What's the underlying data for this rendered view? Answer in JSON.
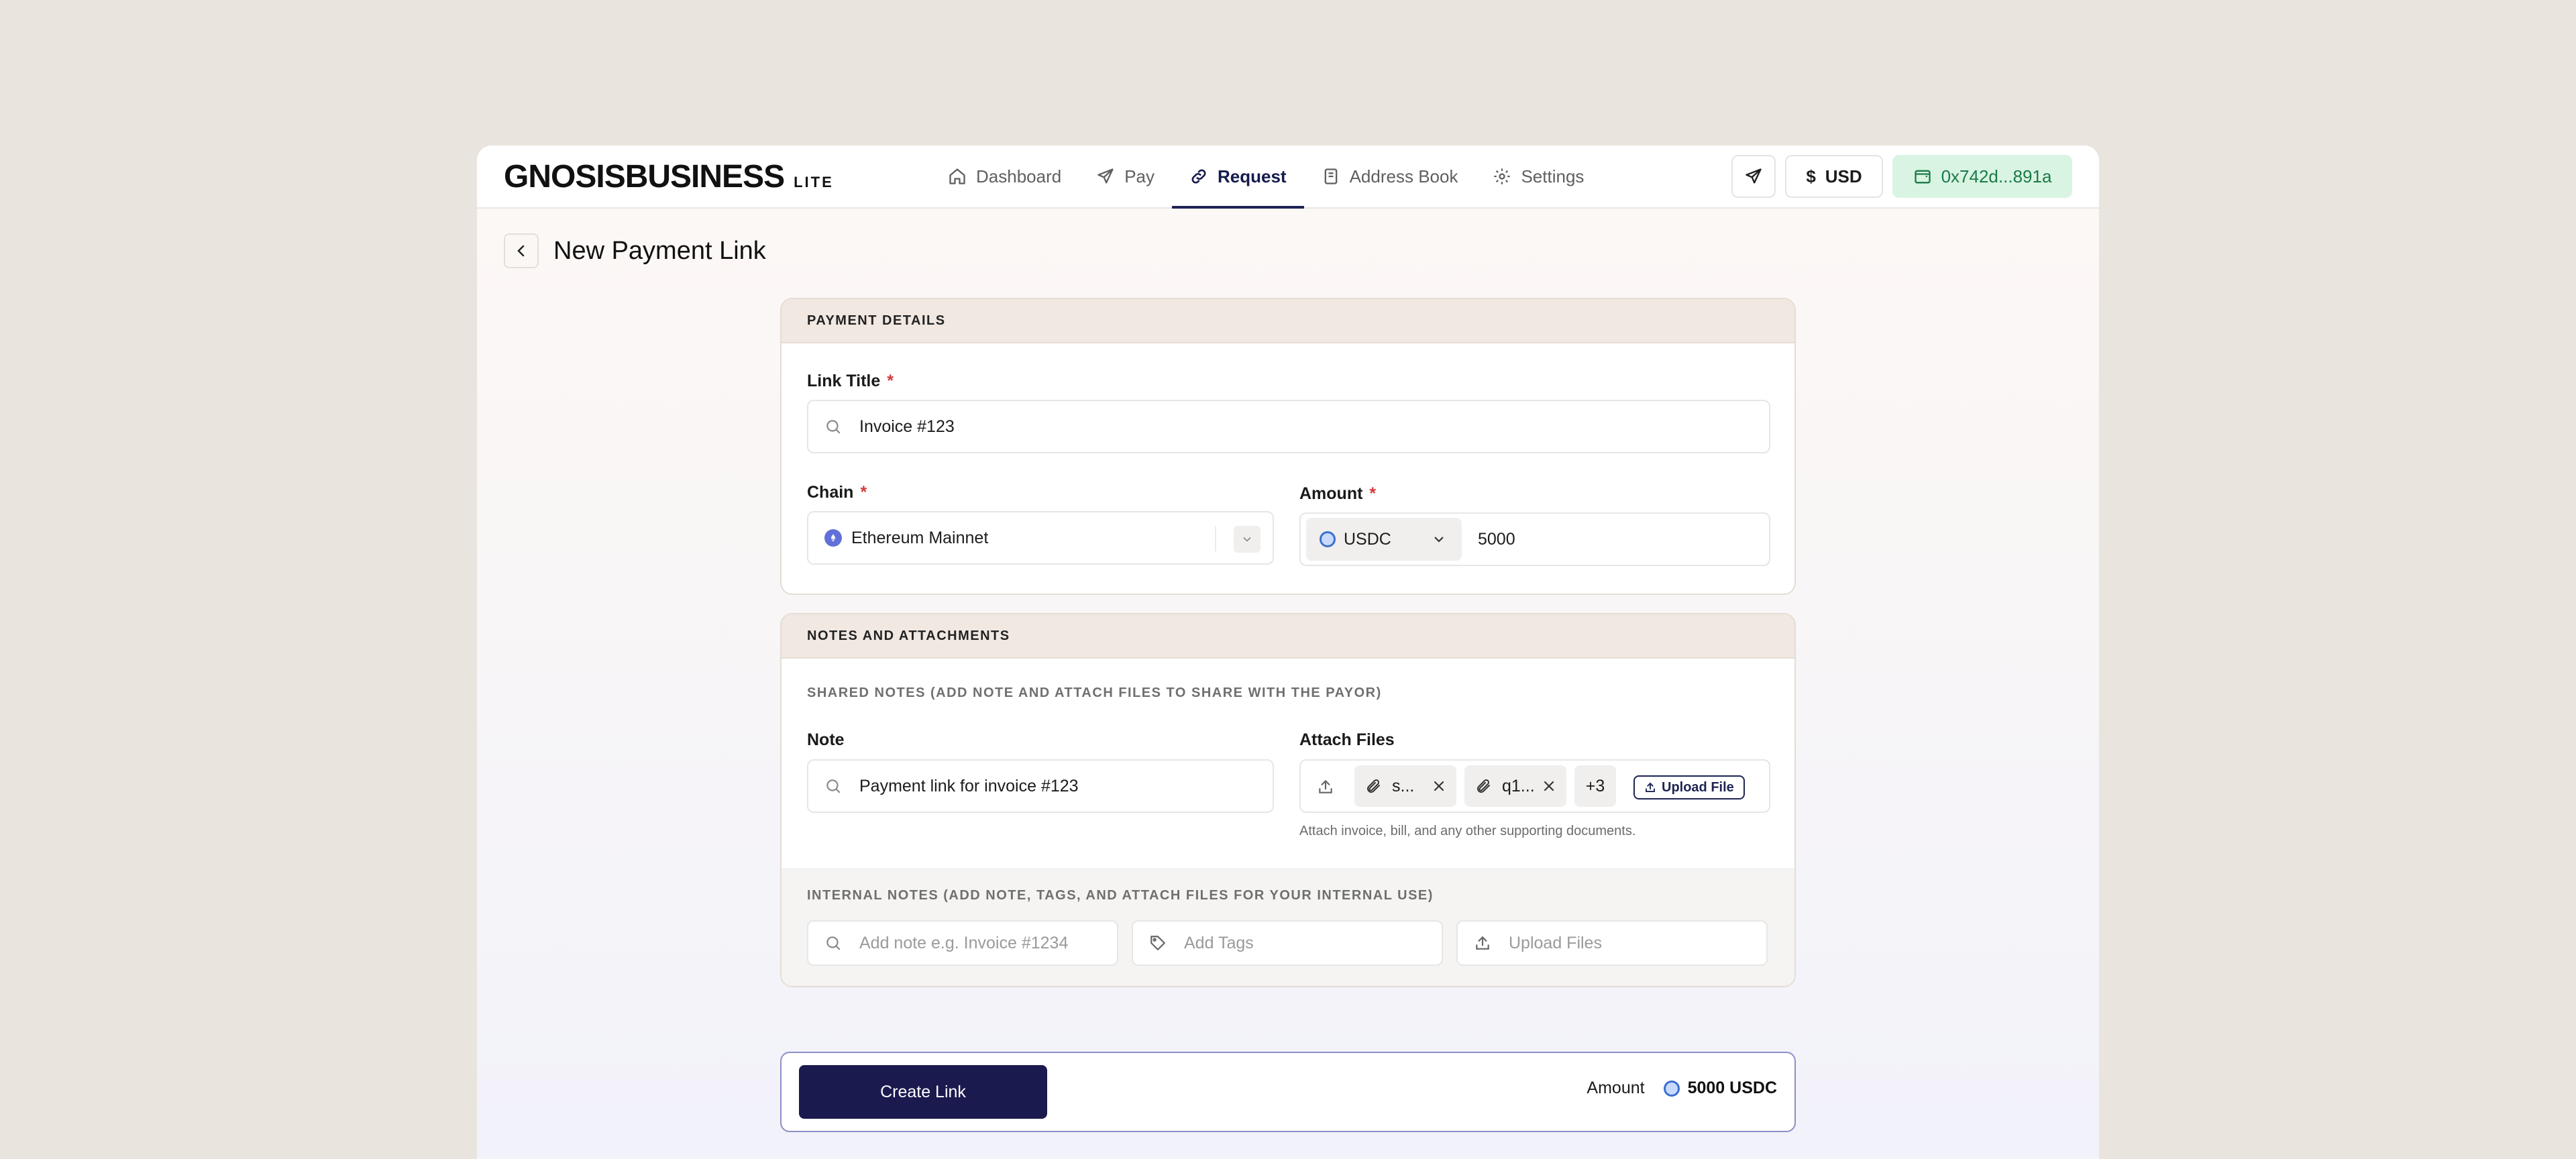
{
  "header": {
    "logo_main": "GNOSISBUSINESS",
    "logo_sub": "LITE",
    "nav": [
      {
        "label": "Dashboard",
        "icon": "home-icon",
        "active": false
      },
      {
        "label": "Pay",
        "icon": "send-icon",
        "active": false
      },
      {
        "label": "Request",
        "icon": "link-icon",
        "active": true
      },
      {
        "label": "Address Book",
        "icon": "book-icon",
        "active": false
      },
      {
        "label": "Settings",
        "icon": "gear-icon",
        "active": false
      }
    ],
    "currency_label": "USD",
    "wallet_address": "0x742d...891a"
  },
  "page": {
    "title": "New Payment Link"
  },
  "payment_details": {
    "section_title": "PAYMENT DETAILS",
    "link_title_label": "Link Title",
    "link_title_value": "Invoice #123",
    "chain_label": "Chain",
    "chain_value": "Ethereum Mainnet",
    "amount_label": "Amount",
    "token": "USDC",
    "amount_value": "5000",
    "required_mark": "*"
  },
  "notes": {
    "section_title": "NOTES AND ATTACHMENTS",
    "shared_heading": "SHARED NOTES (ADD NOTE AND ATTACH FILES TO SHARE WITH THE PAYOR)",
    "note_label": "Note",
    "note_value": "Payment link for invoice #123",
    "attach_label": "Attach Files",
    "files": [
      "s...",
      "q1..."
    ],
    "more_count": "+3",
    "upload_button": "Upload File",
    "attach_hint": "Attach invoice, bill, and any other supporting documents.",
    "internal_heading": "INTERNAL NOTES (ADD NOTE, TAGS, AND ATTACH FILES FOR YOUR INTERNAL USE)",
    "internal_note_placeholder": "Add note e.g. Invoice #1234",
    "tags_placeholder": "Add Tags",
    "upload_files_placeholder": "Upload Files"
  },
  "footer": {
    "create_button": "Create Link",
    "amount_label": "Amount",
    "amount_value": "5000 USDC"
  },
  "colors": {
    "accent": "#1b1a4f",
    "wallet_bg": "#d9f4e3",
    "wallet_text": "#1b7a47",
    "required": "#d23a3a"
  }
}
